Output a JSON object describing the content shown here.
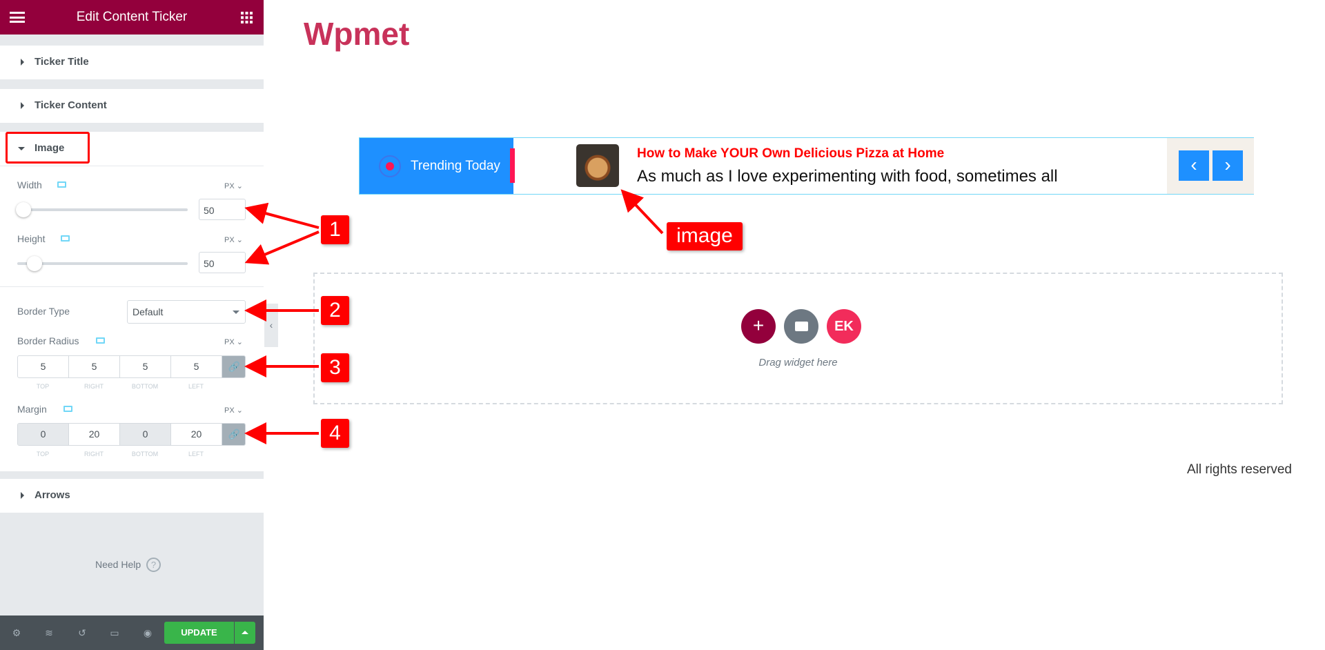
{
  "editor": {
    "title": "Edit Content Ticker",
    "sections": {
      "ticker_title": "Ticker Title",
      "ticker_content": "Ticker Content",
      "image": "Image",
      "arrows": "Arrows"
    },
    "image": {
      "width": {
        "label": "Width",
        "unit": "PX",
        "value": "50",
        "slider_percent": 2
      },
      "height": {
        "label": "Height",
        "unit": "PX",
        "value": "50",
        "slider_percent": 7
      },
      "border_type": {
        "label": "Border Type",
        "value": "Default"
      },
      "border_radius": {
        "label": "Border Radius",
        "unit": "PX",
        "top": "5",
        "right": "5",
        "bottom": "5",
        "left": "5"
      },
      "margin": {
        "label": "Margin",
        "unit": "PX",
        "top": "0",
        "right": "20",
        "bottom": "0",
        "left": "20"
      },
      "dim_labels": {
        "top": "TOP",
        "right": "RIGHT",
        "bottom": "BOTTOM",
        "left": "LEFT"
      }
    },
    "need_help": "Need Help",
    "update_label": "UPDATE"
  },
  "page": {
    "site_title": "Wpmet",
    "ticker": {
      "label": "Trending Today",
      "headline": "How to Make YOUR Own Delicious Pizza at Home",
      "excerpt": "As much as I love experimenting with food, sometimes all"
    },
    "drag_hint": "Drag widget here",
    "footer": "All rights reserved"
  },
  "annotations": {
    "n1": "1",
    "n2": "2",
    "n3": "3",
    "n4": "4",
    "image_label": "image"
  },
  "colors": {
    "brand": "#93003c",
    "ticker_blue": "#1e90ff",
    "headline_red": "#ff0000",
    "update_green": "#39b54a",
    "site_title": "#c8325a"
  }
}
